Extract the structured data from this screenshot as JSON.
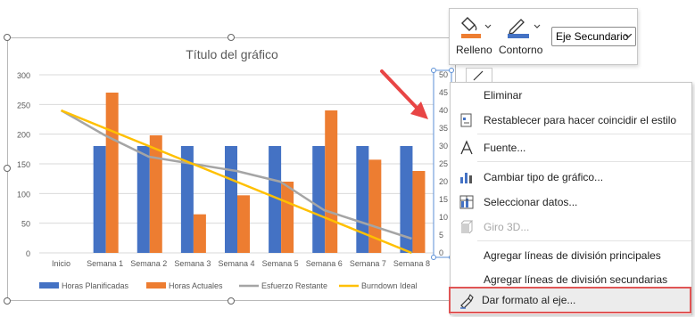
{
  "chart_data": {
    "type": "bar",
    "title": "Título del gráfico",
    "categories": [
      "Inicio",
      "Semana 1",
      "Semana 2",
      "Semana 3",
      "Semana 4",
      "Semana 5",
      "Semana 6",
      "Semana 7",
      "Semana 8"
    ],
    "ylim": [
      0,
      300
    ],
    "yticks": [
      "0",
      "50",
      "100",
      "150",
      "200",
      "250",
      "300"
    ],
    "y2lim": [
      0,
      50
    ],
    "y2ticks": [
      "0",
      "5",
      "10",
      "15",
      "20",
      "25",
      "30",
      "35",
      "40",
      "45",
      "50"
    ],
    "series": [
      {
        "name": "Horas Planificadas",
        "kind": "bar",
        "color": "#4472C4",
        "values": [
          null,
          180,
          180,
          180,
          180,
          180,
          180,
          180,
          180
        ]
      },
      {
        "name": "Horas Actuales",
        "kind": "bar",
        "color": "#ED7D31",
        "values": [
          null,
          270,
          198,
          65,
          97,
          120,
          240,
          157,
          138
        ]
      },
      {
        "name": "Esfuerzo Restante",
        "kind": "line",
        "color": "#A5A5A5",
        "values": [
          40,
          33,
          27,
          25,
          23,
          20,
          12,
          8,
          4
        ]
      },
      {
        "name": "Burndown Ideal",
        "kind": "line",
        "color": "#FFC000",
        "values": [
          40,
          35,
          30,
          25,
          20,
          15,
          10,
          5,
          0
        ]
      }
    ],
    "legend_position": "bottom",
    "grid": true
  },
  "toolbar": {
    "fill_label": "Relleno",
    "outline_label": "Contorno",
    "axis_select": "Eje Secundario",
    "fill_color": "#ED7D31",
    "outline_color": "#4472C4"
  },
  "menu": [
    {
      "label": "Eliminar",
      "icon": "none",
      "disabled": false
    },
    {
      "label": "Restablecer para hacer coincidir el estilo",
      "icon": "reset-style-icon",
      "disabled": false
    },
    {
      "label": "Fuente...",
      "icon": "font-icon",
      "disabled": false
    },
    {
      "label": "Cambiar tipo de gráfico...",
      "icon": "change-chart-type-icon",
      "disabled": false
    },
    {
      "label": "Seleccionar datos...",
      "icon": "select-data-icon",
      "disabled": false
    },
    {
      "label": "Giro 3D...",
      "icon": "3d-rotation-icon",
      "disabled": true
    },
    {
      "label": "Agregar líneas de división principales",
      "icon": "none",
      "disabled": false
    },
    {
      "label": "Agregar líneas de división secundarias",
      "icon": "none",
      "disabled": false
    },
    {
      "label": "Dar formato al eje...",
      "icon": "format-axis-icon",
      "disabled": false
    }
  ],
  "accent": {
    "annotation_arrow": "#E84545",
    "highlight_border": "#E05555"
  }
}
